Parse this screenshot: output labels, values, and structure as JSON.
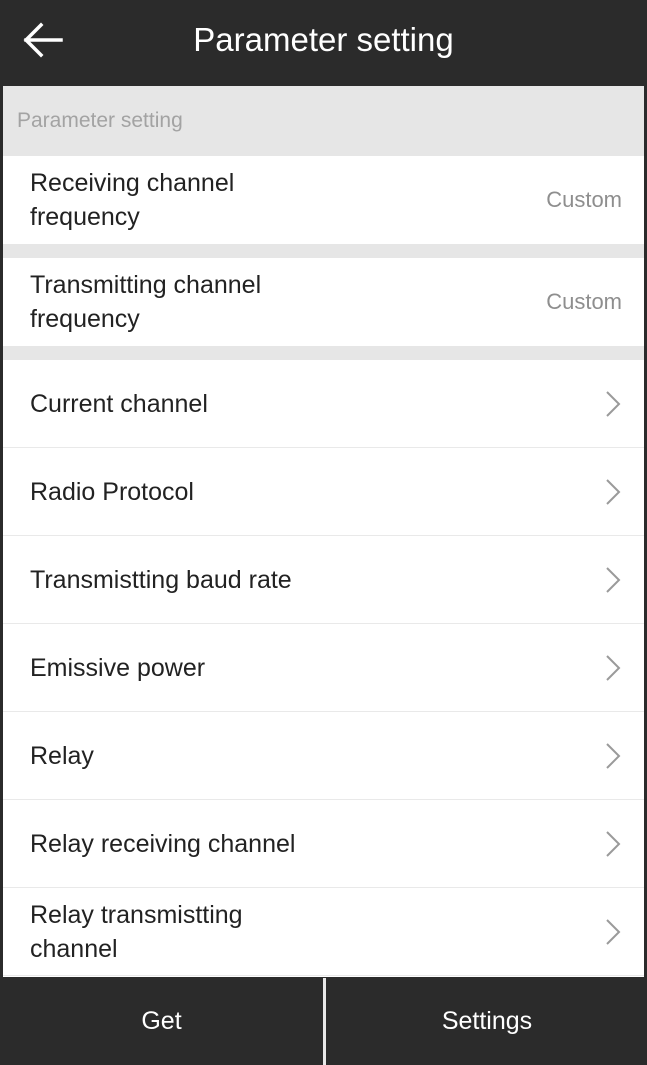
{
  "header": {
    "title": "Parameter setting",
    "back_icon": "arrow-left-icon"
  },
  "section": {
    "label": "Parameter setting"
  },
  "rows": [
    {
      "label": "Receiving channel frequency",
      "value": "Custom"
    },
    {
      "label": "Transmitting channel frequency",
      "value": "Custom"
    }
  ],
  "list": [
    {
      "label": "Current channel"
    },
    {
      "label": "Radio Protocol"
    },
    {
      "label": "Transmistting baud rate"
    },
    {
      "label": "Emissive power"
    },
    {
      "label": "Relay"
    },
    {
      "label": "Relay receiving channel"
    },
    {
      "label": "Relay transmistting channel"
    }
  ],
  "footer": {
    "get_label": "Get",
    "settings_label": "Settings"
  },
  "colors": {
    "bar": "#2b2b2b",
    "section": "#e6e6e6",
    "chevron": "#9a9a9a"
  }
}
